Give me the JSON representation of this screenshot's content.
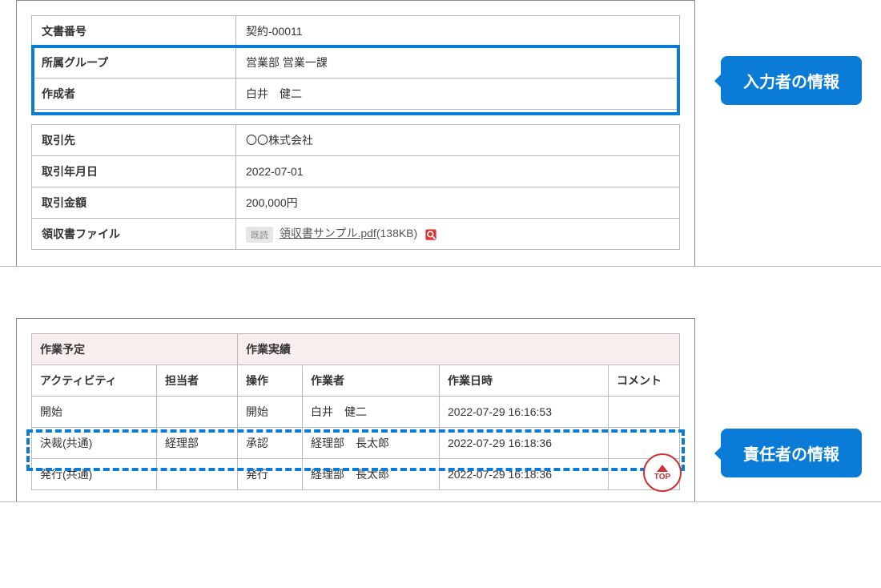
{
  "callouts": {
    "inputter": "入力者の情報",
    "responsible": "責任者の情報"
  },
  "doc": {
    "labels": {
      "doc_no": "文書番号",
      "group": "所属グループ",
      "creator": "作成者"
    },
    "doc_no": "契約-00011",
    "group": "営業部 営業一課",
    "creator": "白井　健二"
  },
  "deal": {
    "labels": {
      "partner": "取引先",
      "date": "取引年月日",
      "amount": "取引金額",
      "receipt": "領収書ファイル"
    },
    "partner": "〇〇株式会社",
    "date": "2022-07-01",
    "amount": "200,000円",
    "receipt": {
      "read_badge": "既読",
      "filename": "領収書サンプル.pdf",
      "size": "(138KB)"
    }
  },
  "activity": {
    "sections": {
      "plan": "作業予定",
      "result": "作業実績"
    },
    "cols": {
      "activity": "アクティビティ",
      "assignee": "担当者",
      "op": "操作",
      "worker": "作業者",
      "datetime": "作業日時",
      "comment": "コメント"
    },
    "rows": [
      {
        "activity": "開始",
        "assignee": "",
        "op": "開始",
        "worker": "白井　健二",
        "datetime": "2022-07-29 16:16:53",
        "comment": ""
      },
      {
        "activity": "決裁(共通)",
        "assignee": "経理部",
        "op": "承認",
        "worker": "経理部　長太郎",
        "datetime": "2022-07-29 16:18:36",
        "comment": ""
      },
      {
        "activity": "発行(共通)",
        "assignee": "",
        "op": "発行",
        "worker": "経理部　長太郎",
        "datetime": "2022-07-29 16:18:36",
        "comment": ""
      }
    ]
  },
  "top_button": "TOP"
}
